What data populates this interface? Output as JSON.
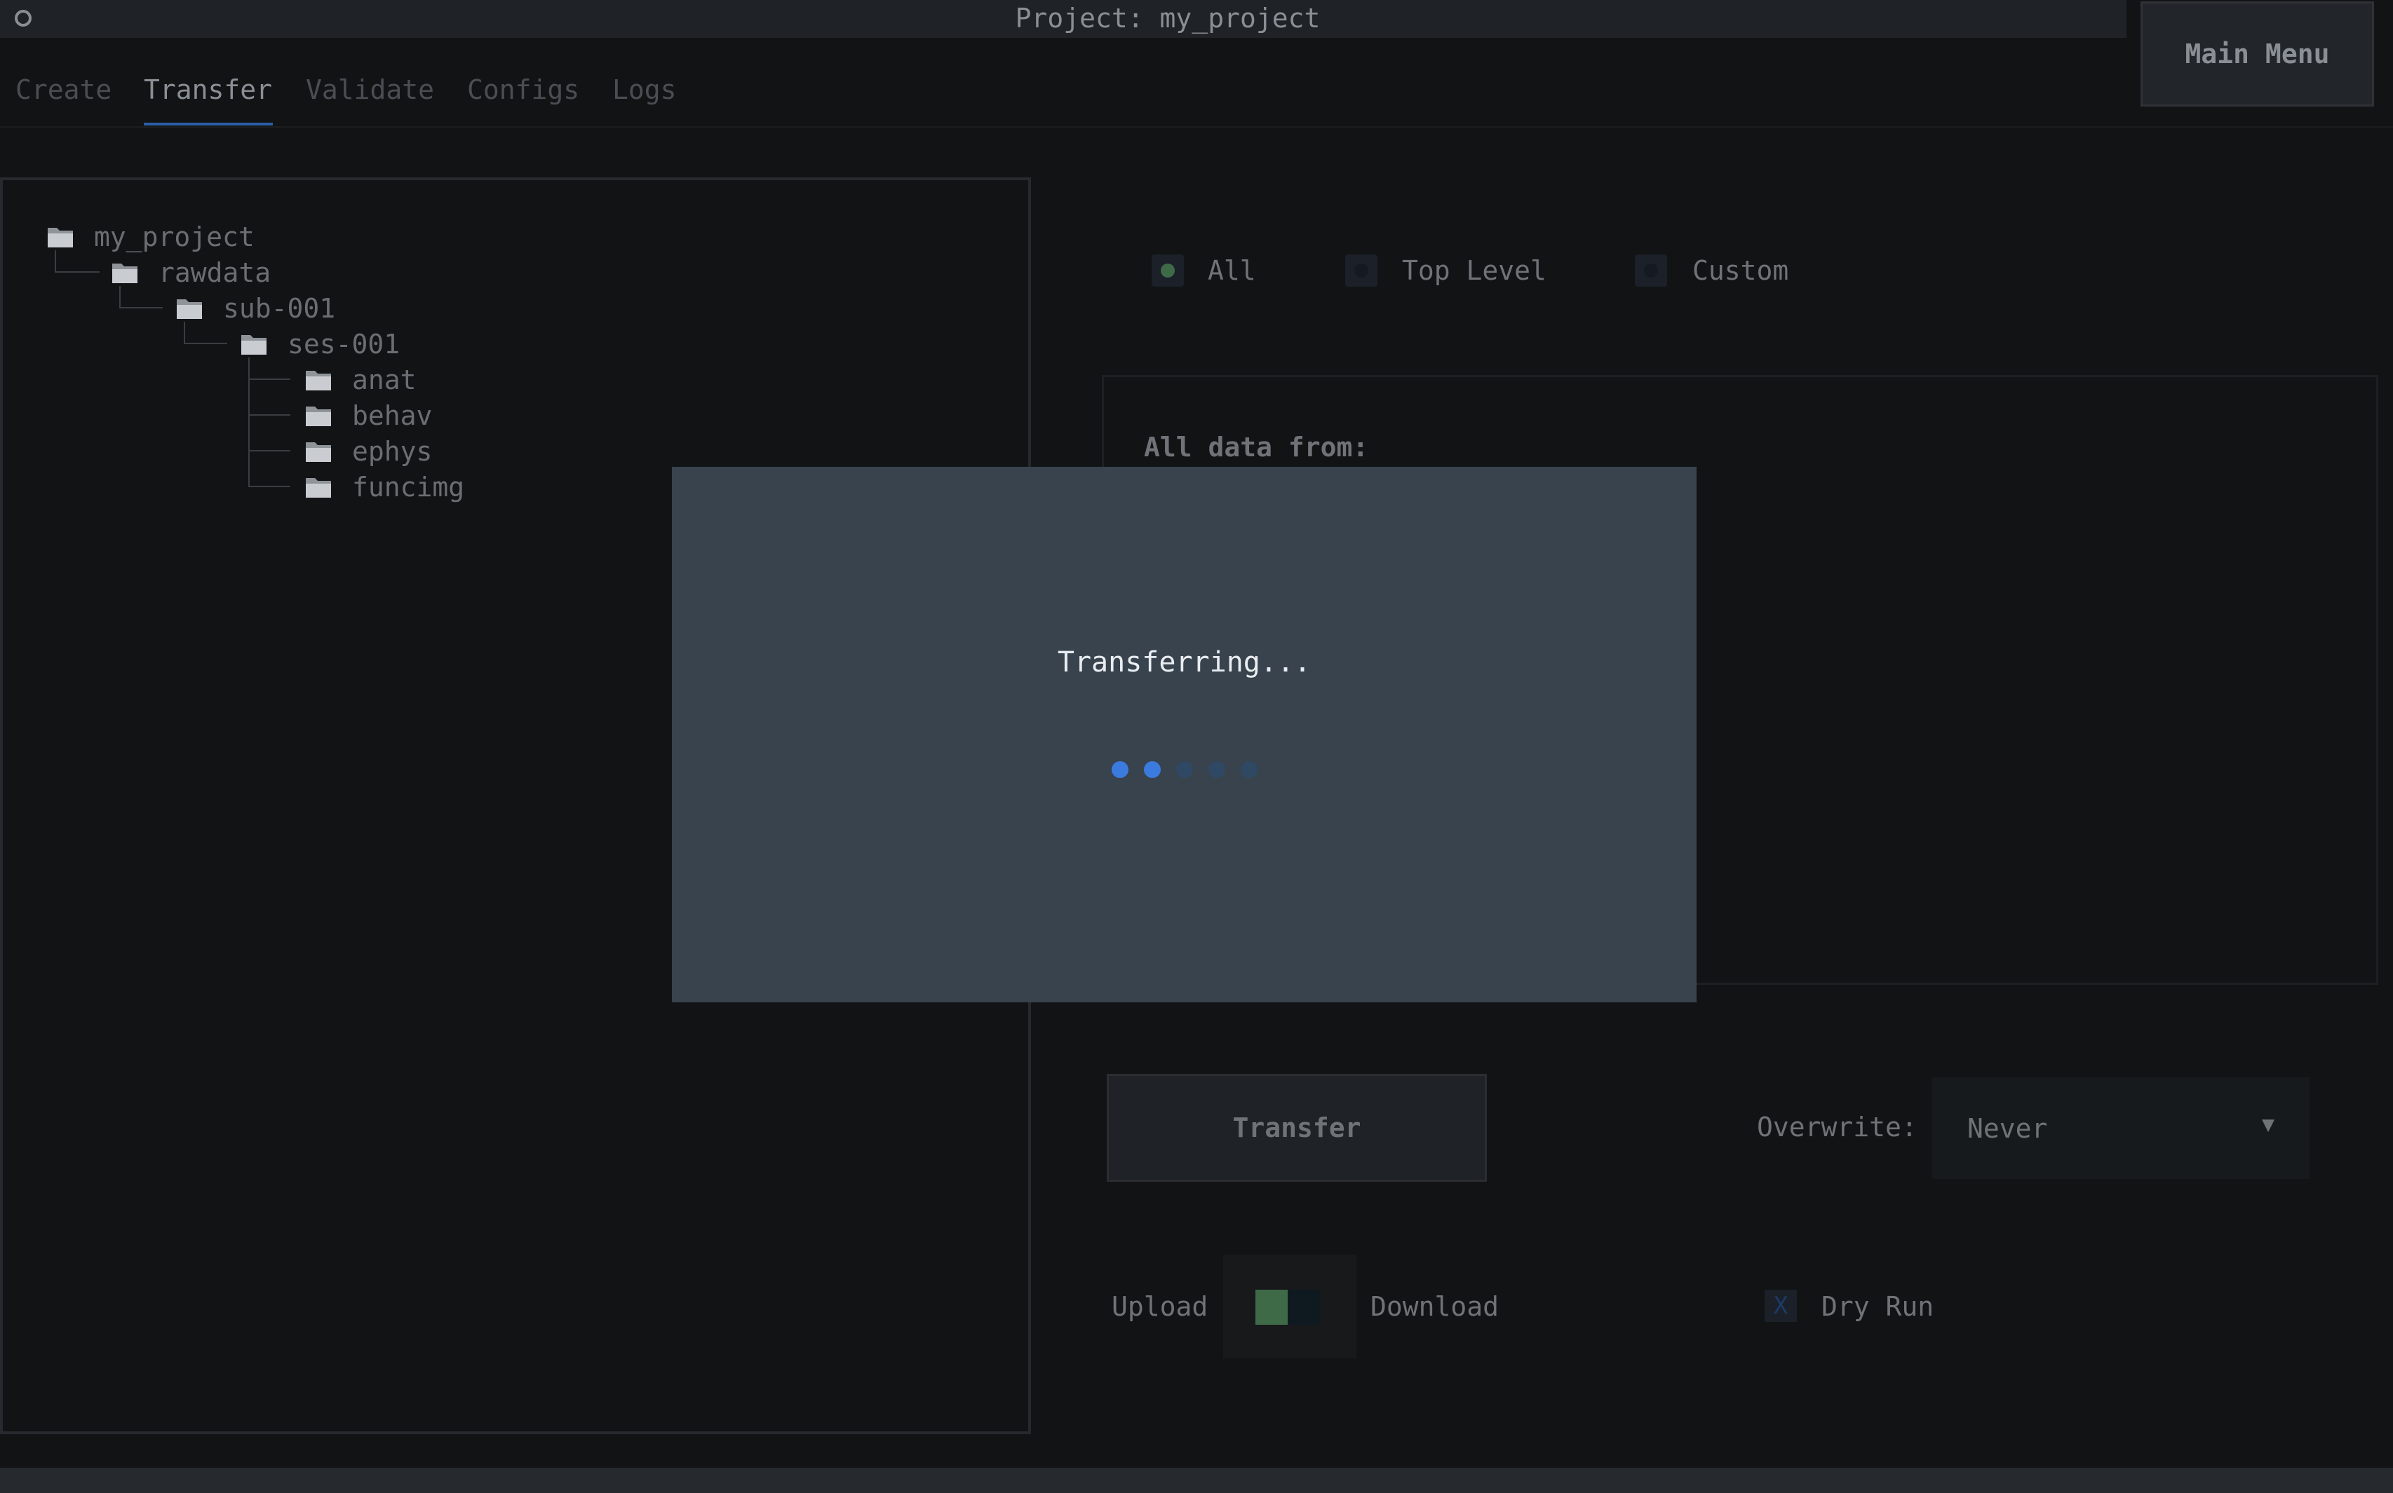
{
  "window": {
    "title": "Project: my_project"
  },
  "main_menu": {
    "label": "Main Menu"
  },
  "tabs": [
    {
      "label": "Create",
      "active": false
    },
    {
      "label": "Transfer",
      "active": true
    },
    {
      "label": "Validate",
      "active": false
    },
    {
      "label": "Configs",
      "active": false
    },
    {
      "label": "Logs",
      "active": false
    }
  ],
  "tree": {
    "items": [
      {
        "label": "my_project",
        "icon": "folder-icon"
      },
      {
        "label": "rawdata",
        "icon": "folder-icon"
      },
      {
        "label": "sub-001",
        "icon": "folder-icon"
      },
      {
        "label": "ses-001",
        "icon": "folder-icon"
      },
      {
        "label": "anat",
        "icon": "folder-icon"
      },
      {
        "label": "behav",
        "icon": "folder-icon"
      },
      {
        "label": "ephys",
        "icon": "folder-icon"
      },
      {
        "label": "funcimg",
        "icon": "folder-icon"
      }
    ]
  },
  "transfer_mode": {
    "options": [
      {
        "label": "All",
        "selected": true
      },
      {
        "label": "Top Level",
        "selected": false
      },
      {
        "label": "Custom",
        "selected": false
      }
    ]
  },
  "details": {
    "text": "All data from:"
  },
  "actions": {
    "transfer_label": "Transfer",
    "overwrite_label": "Overwrite:",
    "overwrite_value": "Never",
    "upload_label": "Upload",
    "download_label": "Download",
    "dry_run_label": "Dry Run",
    "dry_run_mark": "X"
  },
  "modal": {
    "message": "Transferring...",
    "spinner_dots_total": 5,
    "spinner_dots_active": 2
  },
  "colors": {
    "accent": "#2c5fa8",
    "spinner_active": "#3b7be0",
    "spinner_inactive": "#2f4863",
    "toggle_on": "#3f6a48"
  }
}
